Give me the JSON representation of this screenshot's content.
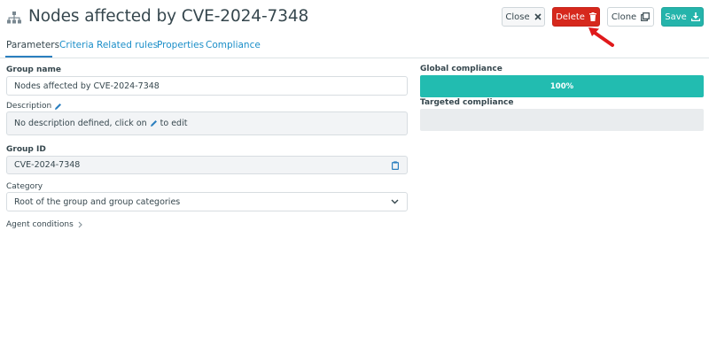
{
  "header": {
    "title": "Nodes affected by CVE-2024-7348",
    "buttons": {
      "close": "Close",
      "delete": "Delete",
      "clone": "Clone",
      "save": "Save"
    }
  },
  "tabs": [
    {
      "label": "Parameters",
      "active": true
    },
    {
      "label": "Criteria",
      "active": false
    },
    {
      "label": "Related rules",
      "active": false
    },
    {
      "label": "Properties",
      "active": false
    },
    {
      "label": "Compliance",
      "active": false
    }
  ],
  "form": {
    "group_name_label": "Group name",
    "group_name_value": "Nodes affected by CVE-2024-7348",
    "description_label": "Description",
    "description_text_before": "No description defined, click on",
    "description_text_after": "to edit",
    "group_id_label": "Group ID",
    "group_id_value": "CVE-2024-7348",
    "category_label": "Category",
    "category_value": "Root of the group and group categories",
    "agent_conditions_label": "Agent conditions"
  },
  "compliance": {
    "global_label": "Global compliance",
    "global_value": "100%",
    "global_fraction": 1.0,
    "targeted_label": "Targeted compliance"
  },
  "colors": {
    "accent": "#1a8ec8",
    "danger": "#d6281c",
    "success": "#25b4ab",
    "compliance_fill": "#22bcb0",
    "annotation_arrow": "#e0191b"
  },
  "icons": {
    "header": "sitemap-icon",
    "close": "close-x-icon",
    "delete": "trash-icon",
    "clone": "clone-icon",
    "save": "download-icon",
    "edit": "pencil-icon",
    "copy": "clipboard-icon",
    "dropdown": "chevron-down-icon",
    "expand": "chevron-right-icon"
  }
}
